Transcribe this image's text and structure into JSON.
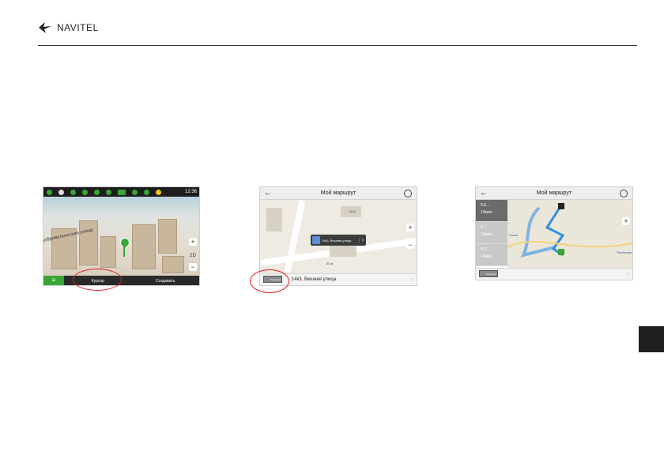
{
  "brand": {
    "name": "NAVITEL"
  },
  "shot1": {
    "time": "12:36",
    "street": "Добровольческая улица",
    "zoom_in": "+",
    "zoom_out": "−",
    "mode": "2D",
    "menu_icon": "≡",
    "cursor_label": "Курсор",
    "create_label": "Создавать"
  },
  "shot2": {
    "title": "Мой маршрут",
    "back": "←",
    "popup_text": "14к3, Вешняя улица",
    "house_label": "14к3",
    "scale": "30 м",
    "flag_label": "Поехали!",
    "address": "14к3, Вешняя улица",
    "zoom_in": "+",
    "zoom_out": "−"
  },
  "shot3": {
    "title": "Мой маршрут",
    "back": "←",
    "routes": [
      {
        "distance": "9.0...",
        "time": "13мин"
      },
      {
        "distance": "8.7...",
        "time": "13мин"
      },
      {
        "distance": "8.2...",
        "time": "14мин"
      }
    ],
    "place1": "Сокол",
    "place2": "Путилково",
    "flag_label": "Поехали!",
    "zoom_in": "+",
    "zoom_out": "−"
  },
  "colors": {
    "accent_green": "#3aa535",
    "highlight_red": "#e01d1d",
    "route_blue": "#2e8fe0"
  }
}
